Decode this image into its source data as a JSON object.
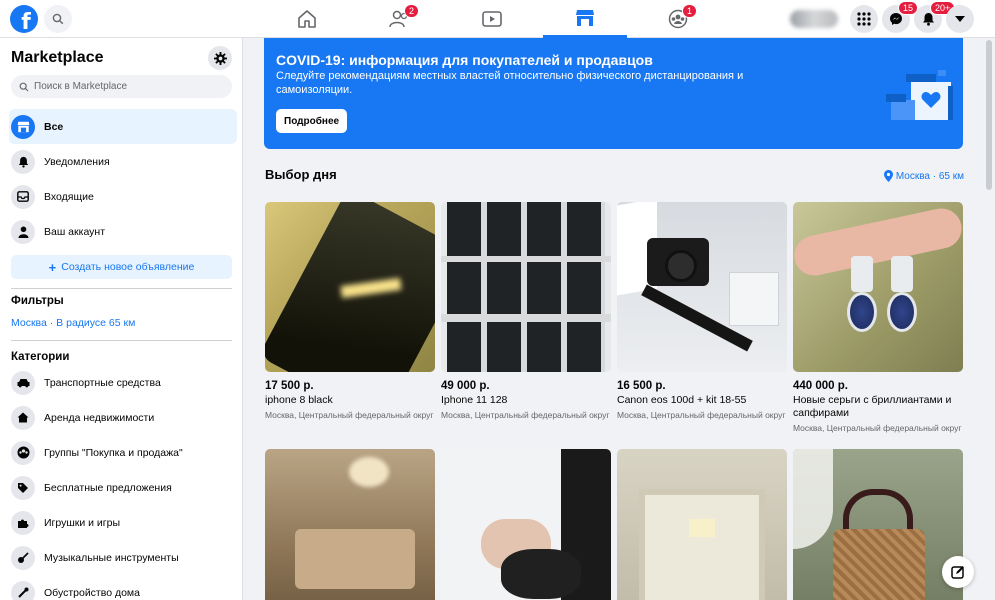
{
  "topbar": {
    "logo_letter": "f",
    "badges": {
      "friends": "2",
      "groups": "1",
      "messenger": "15",
      "notifications": "20+"
    },
    "icons": [
      "home-icon",
      "friends-icon",
      "watch-icon",
      "marketplace-icon",
      "groups-icon",
      "grid-menu-icon",
      "messenger-icon",
      "bell-icon",
      "caret-down-icon"
    ]
  },
  "sidebar": {
    "title": "Marketplace",
    "search_placeholder": "Поиск в Marketplace",
    "nav": [
      {
        "label": "Все",
        "icon": "shop-icon"
      },
      {
        "label": "Уведомления",
        "icon": "bell-icon"
      },
      {
        "label": "Входящие",
        "icon": "inbox-icon"
      },
      {
        "label": "Ваш аккаунт",
        "icon": "person-icon"
      }
    ],
    "create_button": "Создать новое объявление",
    "filters_heading": "Фильтры",
    "filter_location": "Москва · В радиусе 65 км",
    "categories_heading": "Категории",
    "categories": [
      {
        "label": "Транспортные средства",
        "icon": "car-icon"
      },
      {
        "label": "Аренда недвижимости",
        "icon": "house-icon"
      },
      {
        "label": "Группы \"Покупка и продажа\"",
        "icon": "group-icon"
      },
      {
        "label": "Бесплатные предложения",
        "icon": "tag-icon"
      },
      {
        "label": "Игрушки и игры",
        "icon": "puzzle-icon"
      },
      {
        "label": "Музыкальные инструменты",
        "icon": "guitar-icon"
      },
      {
        "label": "Обустройство дома",
        "icon": "tools-icon"
      }
    ]
  },
  "banner": {
    "title": "COVID-19: информация для покупателей и продавцов",
    "text": "Следуйте рекомендациям местных властей относительно физического дистанцирования и самоизоляции.",
    "button": "Подробнее"
  },
  "feed": {
    "title": "Выбор дня",
    "location": "Москва · 65 км",
    "listings": [
      {
        "price": "17 500 р.",
        "title": "iphone 8 black",
        "location": "Москва, Центральный федеральный округ",
        "image": "black-iphone-photo"
      },
      {
        "price": "49 000 р.",
        "title": "Iphone 11 128",
        "location": "Москва, Центральный федеральный округ",
        "image": "iphone-boxes-photo"
      },
      {
        "price": "16 500 р.",
        "title": "Canon eos 100d + kit 18-55",
        "location": "Москва, Центральный федеральный округ",
        "image": "canon-camera-photo"
      },
      {
        "price": "440 000 р.",
        "title": "Новые серьги с бриллиантами и сапфирами",
        "location": "Москва, Центральный федеральный округ",
        "image": "earrings-photo"
      },
      {
        "image": "dining-room-photo"
      },
      {
        "image": "sunglasses-photo"
      },
      {
        "image": "ring-box-photo"
      },
      {
        "image": "basket-bag-photo"
      }
    ]
  }
}
